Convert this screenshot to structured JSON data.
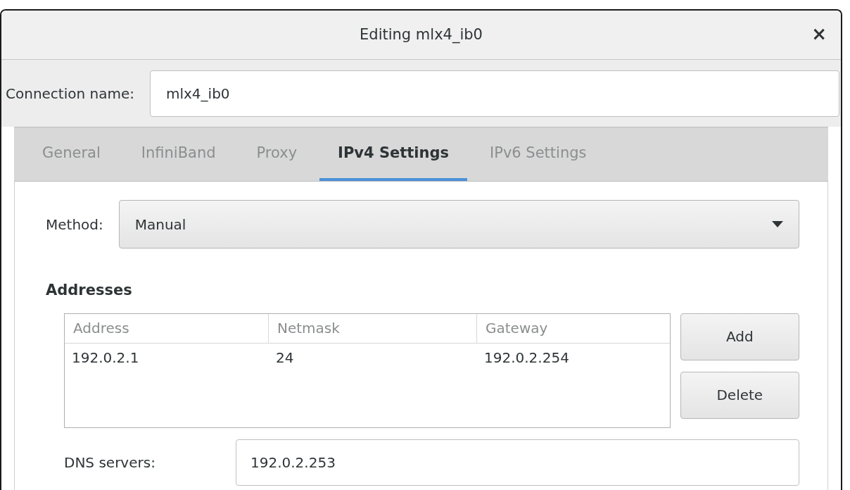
{
  "window": {
    "title": "Editing mlx4_ib0",
    "close": "×"
  },
  "connection_name": {
    "label": "Connection name:",
    "value": "mlx4_ib0"
  },
  "tabs": [
    {
      "label": "General",
      "selected": false
    },
    {
      "label": "InfiniBand",
      "selected": false
    },
    {
      "label": "Proxy",
      "selected": false
    },
    {
      "label": "IPv4 Settings",
      "selected": true
    },
    {
      "label": "IPv6 Settings",
      "selected": false
    }
  ],
  "method": {
    "label": "Method:",
    "value": "Manual"
  },
  "addresses": {
    "heading": "Addresses",
    "columns": [
      "Address",
      "Netmask",
      "Gateway"
    ],
    "rows": [
      [
        "192.0.2.1",
        "24",
        "192.0.2.254"
      ]
    ],
    "buttons": [
      "Add",
      "Delete"
    ]
  },
  "dns": {
    "label": "DNS servers:",
    "value": "192.0.2.253"
  }
}
